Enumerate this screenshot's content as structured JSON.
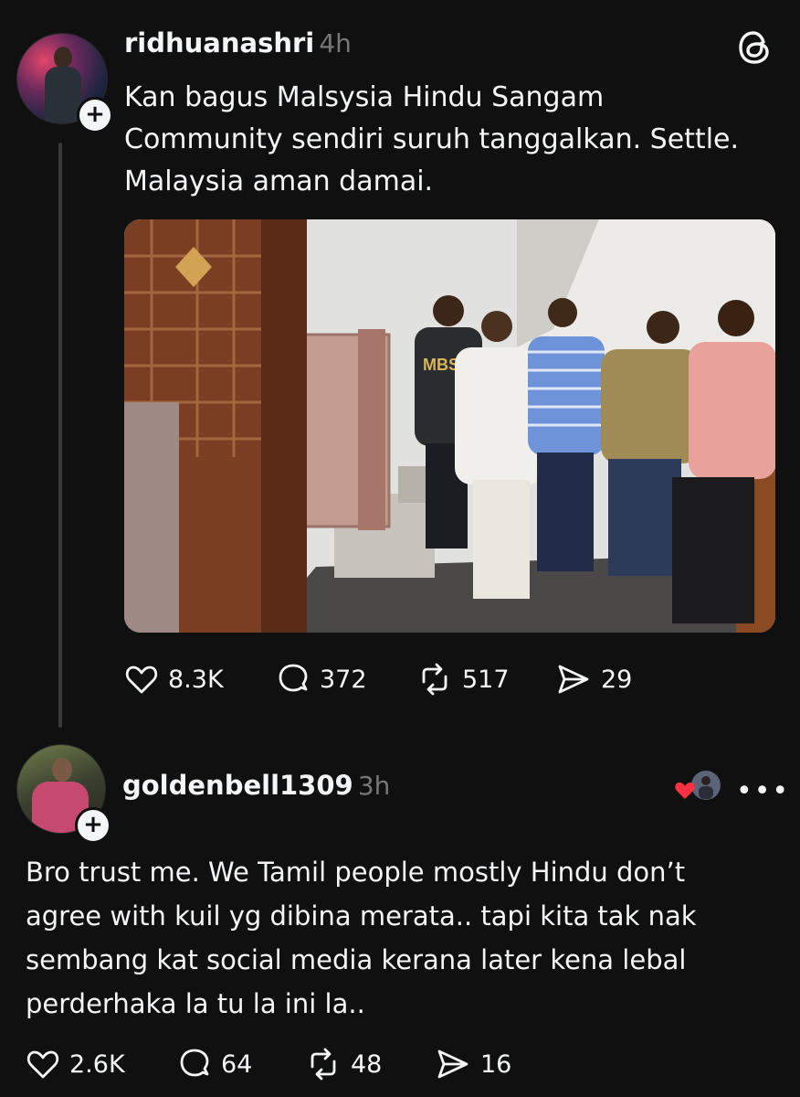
{
  "post": {
    "username": "ridhuanashri",
    "time": "4h",
    "text": "Kan bagus Malsysia Hindu Sangam\nCommunity sendiri suruh tanggalkan. Settle.\nMalaysia aman damai.",
    "image_alt": "Group photo of five men standing in a room beside a wooden door",
    "actions": {
      "likes": "8.3K",
      "replies": "372",
      "reposts": "517",
      "shares": "29"
    },
    "jersey_text": "MBS"
  },
  "reply": {
    "username": "goldenbell1309",
    "time": "3h",
    "text": "Bro trust me. We Tamil people mostly Hindu don’t\nagree with kuil yg dibina merata.. tapi kita tak nak\nsembang kat social media kerana later kena lebal\nperderhaka la tu la ini la..",
    "actions": {
      "likes": "2.6K",
      "replies": "64",
      "reposts": "48",
      "shares": "16"
    },
    "more_label": "•••"
  },
  "icons": {
    "app": "threads-logo-icon",
    "like": "heart-icon",
    "reply": "speech-bubble-icon",
    "repost": "repost-icon",
    "share": "send-icon",
    "follow": "plus-icon"
  },
  "colors": {
    "background": "#101010",
    "text": "#f3f5f7",
    "muted": "#777777",
    "like_red": "#ff3040"
  }
}
